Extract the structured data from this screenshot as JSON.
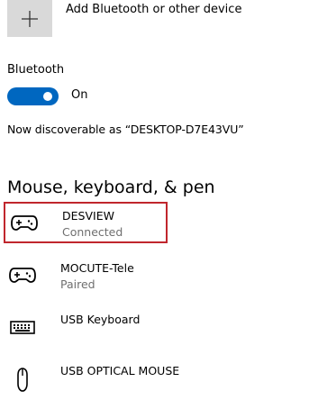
{
  "add_device": {
    "label": "Add Bluetooth or other device",
    "icon": "plus-icon"
  },
  "bluetooth": {
    "heading": "Bluetooth",
    "toggle_state": "On",
    "toggle_on": true,
    "accent_color": "#0067c0",
    "discoverable_text": "Now discoverable as “DESKTOP-D7E43VU”"
  },
  "section": {
    "title": "Mouse, keyboard, & pen"
  },
  "devices": [
    {
      "name": "DESVIEW",
      "status": "Connected",
      "icon": "gamepad-icon",
      "highlighted": true
    },
    {
      "name": "MOCUTE-Tele",
      "status": "Paired",
      "icon": "gamepad-icon"
    },
    {
      "name": "USB Keyboard",
      "status": "",
      "icon": "keyboard-icon"
    },
    {
      "name": "USB OPTICAL MOUSE",
      "status": "",
      "icon": "mouse-icon"
    }
  ],
  "colors": {
    "highlight_border": "#c0262d",
    "status_text": "#6f6f6f",
    "tile_bg": "#d9d9d9"
  }
}
